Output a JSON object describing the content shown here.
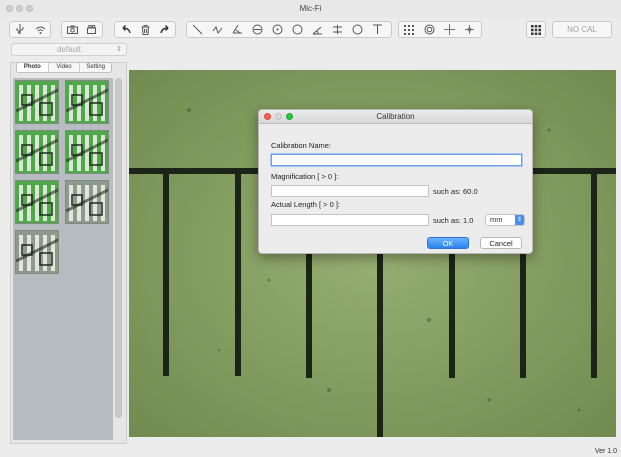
{
  "window": {
    "title": "Mic-Fi",
    "version": "Ver 1.0"
  },
  "toolbar": {
    "groups": [
      {
        "icons": [
          "usb-icon",
          "wifi-icon"
        ]
      },
      {
        "icons": [
          "camera-icon",
          "video-camera-icon"
        ]
      },
      {
        "icons": [
          "undo-icon",
          "trash-icon",
          "redo-icon"
        ]
      },
      {
        "icons": [
          "line-tool-icon",
          "polyline-tool-icon",
          "angle-tool-icon",
          "circle-3pt-icon",
          "circle-center-icon",
          "circle-tool-icon",
          "angle-arc-icon",
          "parallel-lines-icon",
          "polygon-tool-icon",
          "text-tool-icon"
        ]
      },
      {
        "icons": [
          "grid-icon",
          "target-icon",
          "crosshair-icon",
          "crosshair-small-icon"
        ]
      }
    ],
    "layout_icon": "grid-dots-icon",
    "calibration_value": "NO CAL"
  },
  "sidebar": {
    "profile": "default",
    "tabs": [
      {
        "label": "Photo",
        "active": true
      },
      {
        "label": "Video",
        "active": false
      },
      {
        "label": "Setting",
        "active": false
      }
    ],
    "thumbnail_count": 7
  },
  "dialog": {
    "title": "Calibration",
    "name_label": "Calibration Name:",
    "name_value": "",
    "magnification_label": "Magnification [ > 0 ]:",
    "magnification_value": "",
    "magnification_hint": "such as: 60.0",
    "length_label": "Actual Length [ > 0 ]:",
    "length_value": "",
    "length_hint": "such as: 1.0",
    "unit": "mm",
    "ok_label": "OK",
    "cancel_label": "Cancel"
  },
  "colors": {
    "specimen_green": "#8ea767",
    "scale_lines": "#1c2418",
    "accent_blue": "#2a82f0"
  }
}
